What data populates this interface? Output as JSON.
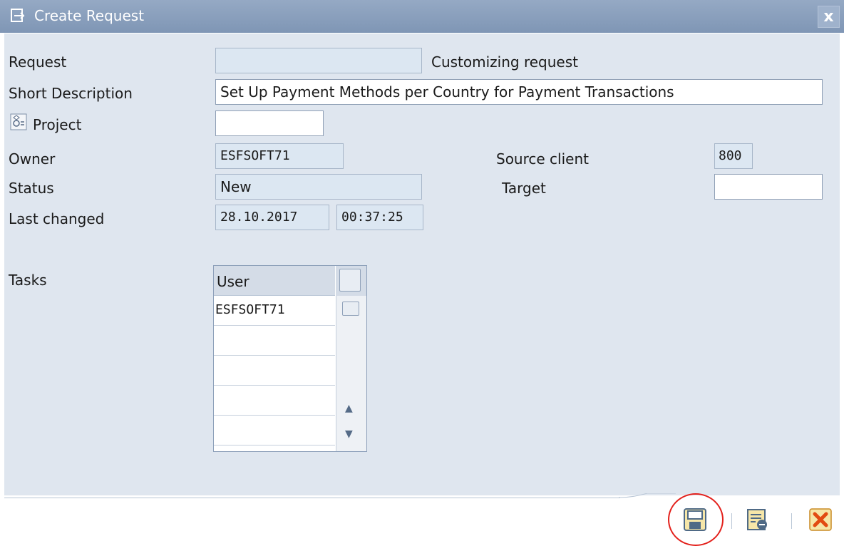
{
  "window": {
    "title": "Create Request",
    "close_symbol": "x"
  },
  "form": {
    "request": {
      "label": "Request",
      "value": "",
      "info": "Customizing request"
    },
    "short_description": {
      "label": "Short Description",
      "value": "Set Up Payment Methods per Country for Payment Transactions"
    },
    "project": {
      "label": "Project",
      "value": ""
    },
    "owner": {
      "label": "Owner",
      "value": "ESFSOFT71"
    },
    "source_client": {
      "label": "Source client",
      "value": "800"
    },
    "status": {
      "label": "Status",
      "value": "New"
    },
    "target": {
      "label": "Target",
      "value": ""
    },
    "last_changed": {
      "label": "Last changed",
      "date": "28.10.2017",
      "time": "00:37:25"
    }
  },
  "tasks": {
    "label": "Tasks",
    "column_header": "User",
    "rows": [
      "ESFSOFT71",
      "",
      "",
      "",
      ""
    ]
  },
  "toolbar": {
    "buttons": [
      {
        "icon": "save-icon",
        "highlighted": true
      },
      {
        "icon": "choose-local-change-icon",
        "highlighted": false
      },
      {
        "icon": "cancel-icon",
        "highlighted": false
      }
    ]
  },
  "colors": {
    "titlebar": "#8aa0bd",
    "content_bg": "#dfe6ef",
    "highlight_circle": "#e3201b",
    "cancel_icon": "#e24b12"
  }
}
